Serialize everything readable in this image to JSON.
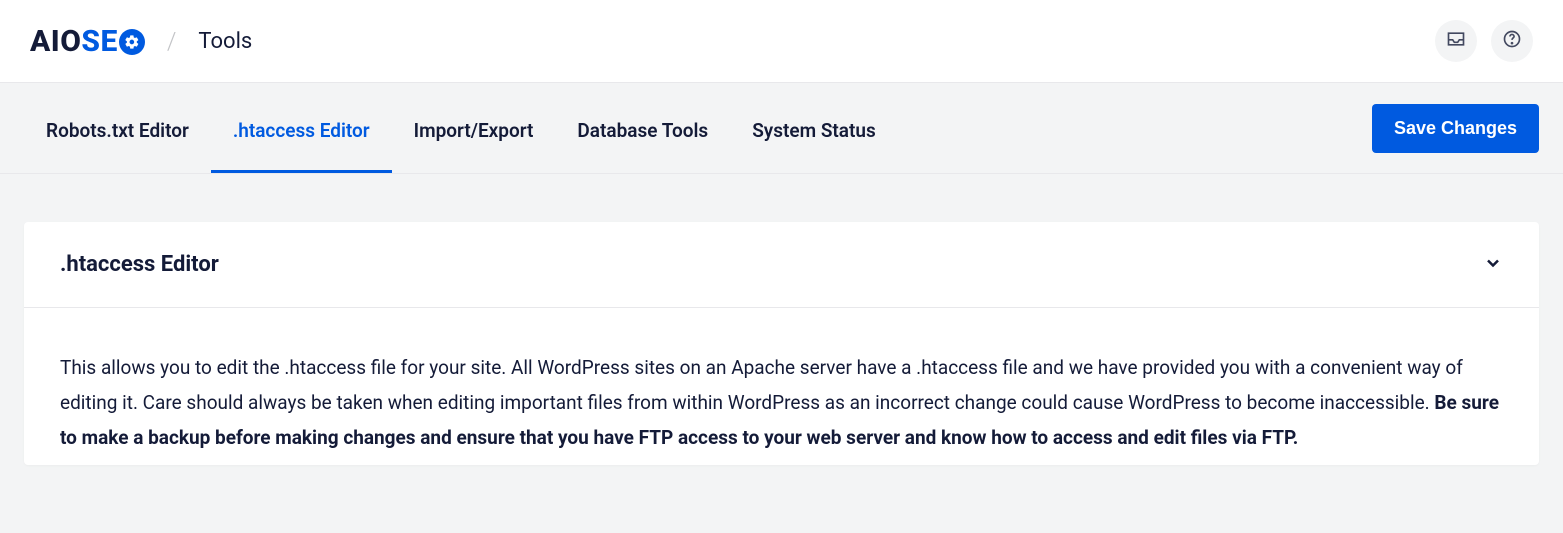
{
  "header": {
    "logo_aio": "AIO",
    "logo_se": "SE",
    "page_name": "Tools"
  },
  "tabs": [
    {
      "label": "Robots.txt Editor",
      "active": false
    },
    {
      "label": ".htaccess Editor",
      "active": true
    },
    {
      "label": "Import/Export",
      "active": false
    },
    {
      "label": "Database Tools",
      "active": false
    },
    {
      "label": "System Status",
      "active": false
    }
  ],
  "actions": {
    "save_label": "Save Changes"
  },
  "card": {
    "title": ".htaccess Editor",
    "body_plain": "This allows you to edit the .htaccess file for your site. All WordPress sites on an Apache server have a .htaccess file and we have provided you with a convenient way of editing it. Care should always be taken when editing important files from within WordPress as an incorrect change could cause WordPress to become inaccessible. ",
    "body_bold": "Be sure to make a backup before making changes and ensure that you have FTP access to your web server and know how to access and edit files via FTP."
  }
}
